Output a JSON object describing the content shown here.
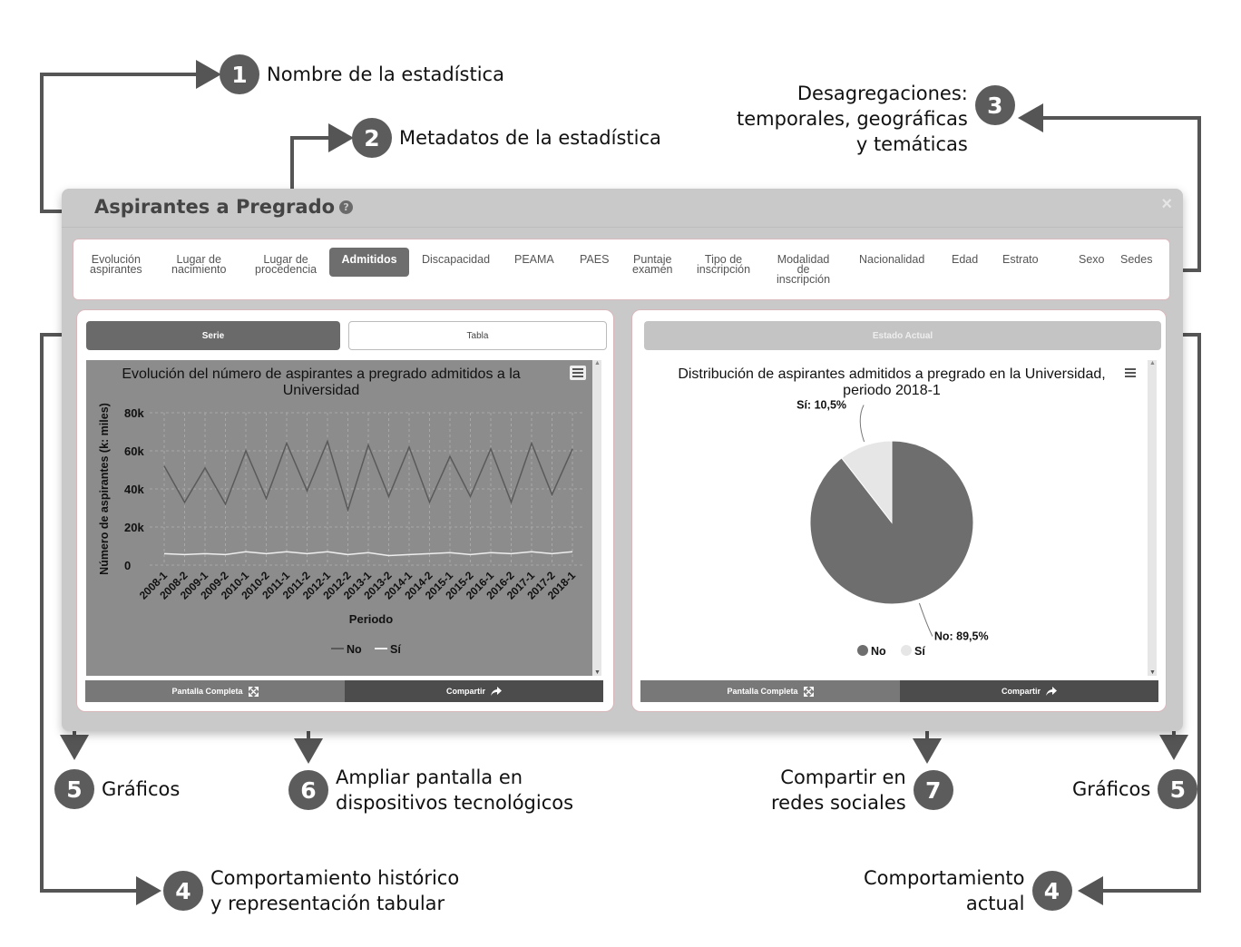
{
  "callouts": {
    "c1": {
      "num": "1",
      "text": "Nombre de la estadística"
    },
    "c2": {
      "num": "2",
      "text": "Metadatos de la estadística"
    },
    "c3": {
      "num": "3",
      "line1": "Desagregaciones:",
      "line2": "temporales, geográficas",
      "line3": "y temáticas"
    },
    "c4a": {
      "num": "4",
      "line1": "Comportamiento histórico",
      "line2": "y representación tabular"
    },
    "c4b": {
      "num": "4",
      "line1": "Comportamiento",
      "line2": "actual"
    },
    "c5a": {
      "num": "5",
      "text": "Gráficos"
    },
    "c5b": {
      "num": "5",
      "text": "Gráficos"
    },
    "c6": {
      "num": "6",
      "line1": "Ampliar pantalla en",
      "line2": "dispositivos tecnológicos"
    },
    "c7": {
      "num": "7",
      "line1": "Compartir en",
      "line2": "redes sociales"
    }
  },
  "panel": {
    "title": "Aspirantes a Pregrado",
    "help_icon": "?",
    "close_icon": "×"
  },
  "tabs": [
    {
      "l1": "Evolución",
      "l2": "aspirantes",
      "l3": ""
    },
    {
      "l1": "Lugar de",
      "l2": "nacimiento",
      "l3": ""
    },
    {
      "l1": "Lugar de",
      "l2": "procedencia",
      "l3": ""
    },
    {
      "l1": "Admitidos",
      "l2": "",
      "l3": ""
    },
    {
      "l1": "Discapacidad",
      "l2": "",
      "l3": ""
    },
    {
      "l1": "PEAMA",
      "l2": "",
      "l3": ""
    },
    {
      "l1": "PAES",
      "l2": "",
      "l3": ""
    },
    {
      "l1": "Puntaje",
      "l2": "examen",
      "l3": ""
    },
    {
      "l1": "Tipo de",
      "l2": "inscripción",
      "l3": ""
    },
    {
      "l1": "Modalidad",
      "l2": "de",
      "l3": "inscripción"
    },
    {
      "l1": "Nacionalidad",
      "l2": "",
      "l3": ""
    },
    {
      "l1": "Edad",
      "l2": "",
      "l3": ""
    },
    {
      "l1": "Estrato",
      "l2": "",
      "l3": ""
    },
    {
      "l1": "Sexo",
      "l2": "",
      "l3": ""
    },
    {
      "l1": "Sedes",
      "l2": "",
      "l3": ""
    }
  ],
  "left_card": {
    "serie_label": "Serie",
    "tabla_label": "Tabla",
    "fullscreen_label": "Pantalla Completa",
    "share_label": "Compartir"
  },
  "right_card": {
    "estado_label": "Estado Actual",
    "fullscreen_label": "Pantalla Completa",
    "share_label": "Compartir"
  },
  "icons": {
    "menu": "hamburger-menu-icon",
    "fullscreen": "fullscreen-icon",
    "share": "share-arrow-icon"
  },
  "colors": {
    "badge": "#5c5c5c",
    "line_no": "#5a5a5a",
    "line_si": "#eeeeee",
    "pie_no": "#6e6e6e",
    "pie_si": "#e6e6e6"
  },
  "chart_data": [
    {
      "type": "line",
      "title": "Evolución del número de aspirantes a pregrado admitidos a la Universidad",
      "xlabel": "Periodo",
      "ylabel": "Número de aspirantes (k: miles)",
      "ylim": [
        0,
        80000
      ],
      "yticks": [
        "0",
        "20k",
        "40k",
        "60k",
        "80k"
      ],
      "grid": true,
      "legend": "bottom",
      "categories": [
        "2008-1",
        "2008-2",
        "2009-1",
        "2009-2",
        "2010-1",
        "2010-2",
        "2011-1",
        "2011-2",
        "2012-1",
        "2012-2",
        "2013-1",
        "2013-2",
        "2014-1",
        "2014-2",
        "2015-1",
        "2015-2",
        "2016-1",
        "2016-2",
        "2017-1",
        "2017-2",
        "2018-1"
      ],
      "series": [
        {
          "name": "No",
          "values": [
            52000,
            33000,
            51000,
            32000,
            60000,
            35000,
            64000,
            39000,
            65000,
            29000,
            63000,
            36000,
            62000,
            33000,
            57000,
            36000,
            61000,
            33000,
            64000,
            37000,
            61000
          ]
        },
        {
          "name": "Sí",
          "values": [
            6000,
            5500,
            6000,
            5500,
            7000,
            6000,
            7000,
            6000,
            7000,
            5500,
            6500,
            5000,
            5500,
            6000,
            6500,
            5500,
            6500,
            6000,
            7000,
            6000,
            7000
          ]
        }
      ]
    },
    {
      "type": "pie",
      "title": "Distribución de aspirantes admitidos a pregrado en la Universidad, periodo 2018-1",
      "legend": "bottom",
      "slices": [
        {
          "name": "No",
          "value": 89.5,
          "label": "No: 89,5%"
        },
        {
          "name": "Sí",
          "value": 10.5,
          "label": "Sí: 10,5%"
        }
      ]
    }
  ]
}
